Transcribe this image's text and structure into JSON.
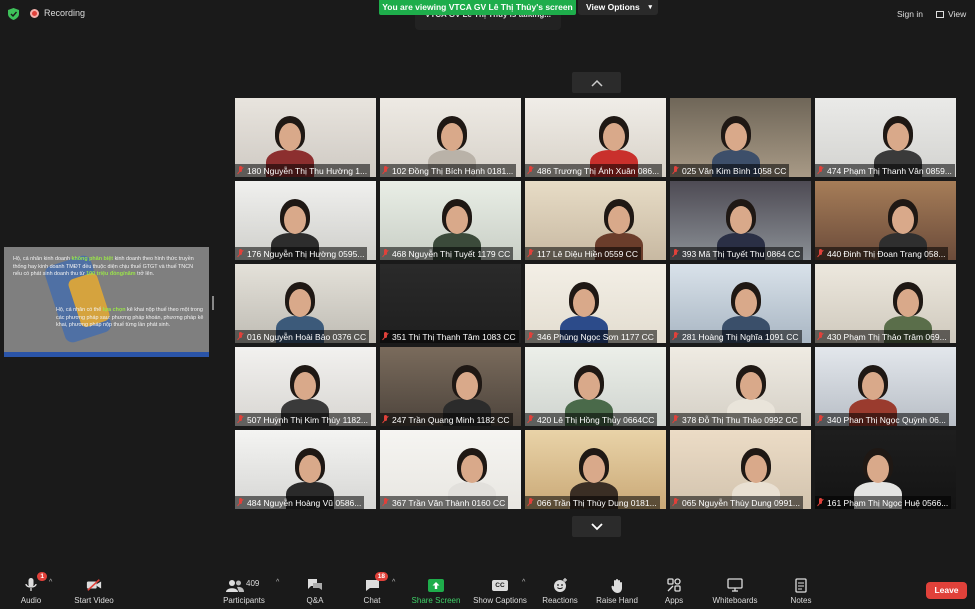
{
  "top": {
    "recording_label": "Recording",
    "viewing_banner": "You are viewing VTCA GV Lê Thị Thủy's screen",
    "view_options_label": "View Options",
    "talking_label": "VTCA GV Lê Thị Thủy is talking...",
    "sign_in_label": "Sign in",
    "view_label": "View"
  },
  "shared_screen": {
    "line1_pre": "Hộ, cá nhân kinh doanh ",
    "line1_hl": "không phân biệt",
    "line1_post": " kinh doanh theo hình thức truyền thống hay kinh doanh TMĐT đều thuộc diện chịu thuế GTGT và thuế TNCN nếu có phát sinh doanh thu từ ",
    "line1_hl2": "100 triệu đồng/năm",
    "line1_end": " trở lên.",
    "line2_pre": "Hộ, cá nhân có thể ",
    "line2_hl": "lựa chọn",
    "line2_post": " kê khai nộp thuế theo một trong các phương pháp sau: phương pháp khoán, phương pháp kê khai, phương pháp nộp thuế từng lần phát sinh."
  },
  "participants": [
    "180 Nguyễn Thị Thu Hường 1...",
    "102 Đồng Thị Bích Hạnh 0181...",
    "486 Trương Thị Ánh Xuân 086...",
    "025 Văn Kim Bình 1058 CC",
    "474 Phạm Thị Thanh Vân 0859...",
    "176 Nguyễn Thị Hường 0595...",
    "468 Nguyễn Thị Tuyết 1179 CC",
    "117 Lê Diệu Hiền 0559 CC",
    "393 Mã Thị Tuyết Thu 0864 CC",
    "440 Đinh Thị Đoan Trang 058...",
    "016 Nguyễn Hoài Bảo 0376 CC",
    "351 Thi Thị Thanh Tâm 1083 CC",
    "346 Phùng Ngọc Sơn 1177 CC",
    "281 Hoàng Thị Nghĩa 1091 CC",
    "430 Phạm Thị Thảo Trâm 069...",
    "507 Huỳnh Thị Kim Thùy 1182...",
    "247 Trần Quang Minh 1182 CC",
    "420 Lê Thị Hồng Thủy 0664CC",
    "378 Đỗ Thị Thu Thảo 0992 CC",
    "340 Phan Thị Ngọc Quỳnh 06...",
    "484 Nguyễn Hoàng Vũ 0586...",
    "367 Trần Văn Thành 0160 CC",
    "066 Trần Thị Thùy Dung 0181...",
    "065 Nguyễn Thùy Dung 0991...",
    "161 Phạm Thị Ngọc Huệ 0566..."
  ],
  "toolbar": {
    "audio": "Audio",
    "audio_badge": "1",
    "start_video": "Start Video",
    "participants": "Participants",
    "participants_count": "409",
    "qa": "Q&A",
    "chat": "Chat",
    "chat_badge": "18",
    "share_screen": "Share Screen",
    "show_captions": "Show Captions",
    "captions_icon_text": "CC",
    "reactions": "Reactions",
    "raise_hand": "Raise Hand",
    "apps": "Apps",
    "whiteboards": "Whiteboards",
    "notes": "Notes",
    "leave": "Leave"
  },
  "colors": {
    "accent_green": "#1ead4b",
    "leave_red": "#e0413a",
    "background": "#1a1a1a"
  }
}
